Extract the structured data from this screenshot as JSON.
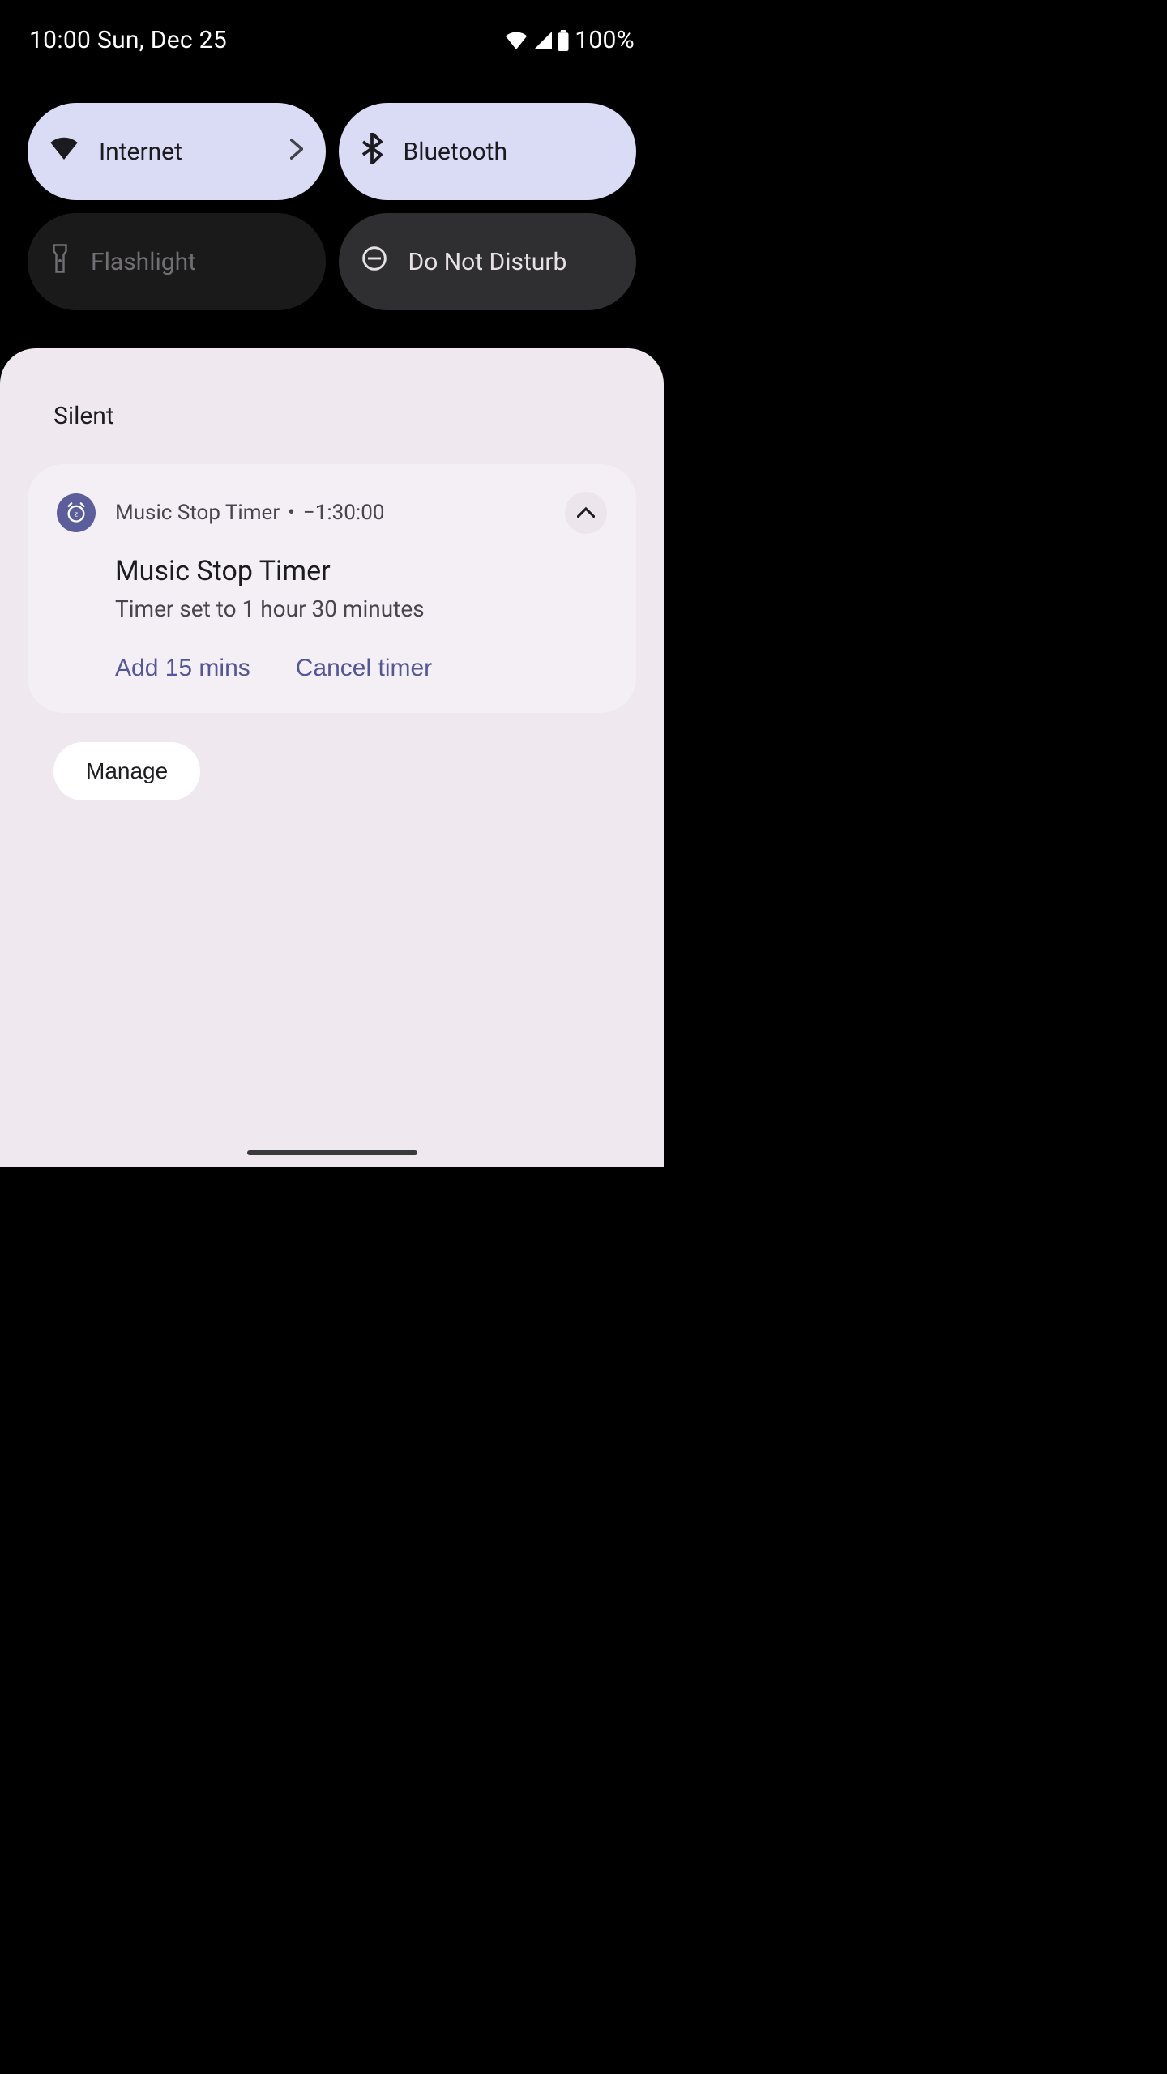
{
  "status": {
    "time": "10:00",
    "date": "Sun, Dec 25",
    "battery": "100%"
  },
  "tiles": {
    "internet": "Internet",
    "bluetooth": "Bluetooth",
    "flashlight": "Flashlight",
    "dnd": "Do Not Disturb"
  },
  "shade": {
    "section": "Silent",
    "notification": {
      "app": "Music Stop Timer",
      "separator": "•",
      "countdown": "−1:30:00",
      "title": "Music Stop Timer",
      "body": "Timer set to 1 hour 30 minutes",
      "action_add": "Add 15 mins",
      "action_cancel": "Cancel timer"
    },
    "manage": "Manage"
  }
}
